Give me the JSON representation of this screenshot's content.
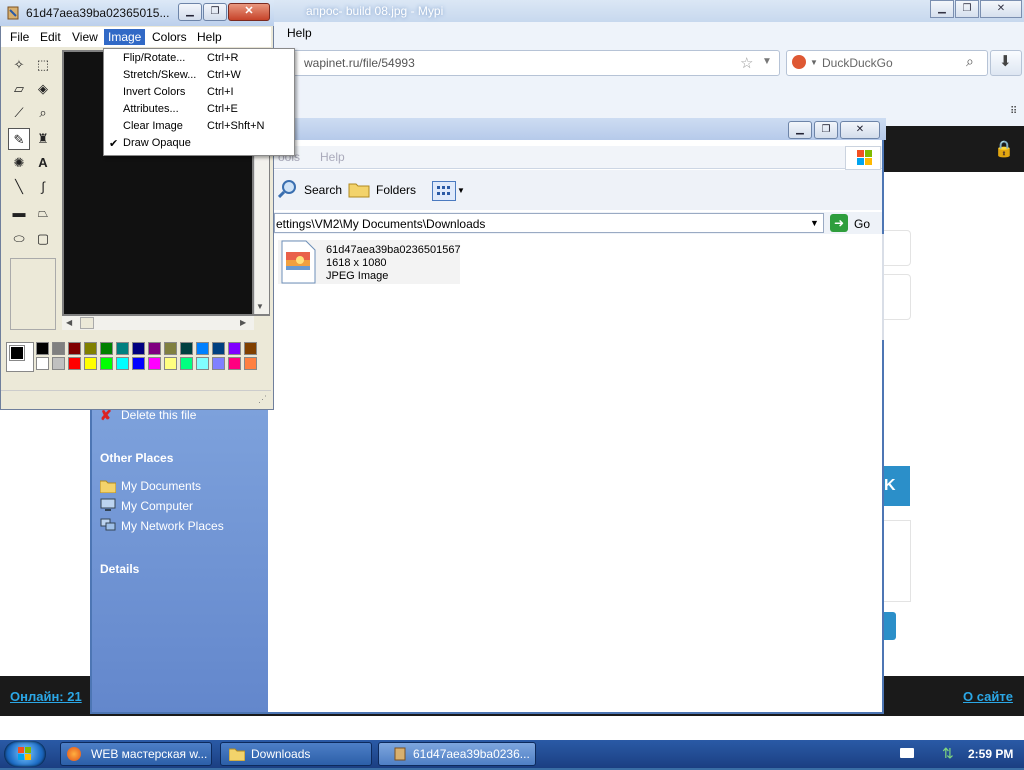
{
  "firefox": {
    "title": "апрос- build 08.jpg - Мурі",
    "menu_help": "Help",
    "url": "wapinet.ru/file/54993",
    "search_placeholder": "DuckDuckGo",
    "site": {
      "online": "Онлайн: 21",
      "about": "О сайте",
      "blue_box_text": "K"
    }
  },
  "explorer": {
    "menu_tools": "ools",
    "menu_help": "Help",
    "toolbar_search": "Search",
    "toolbar_folders": "Folders",
    "address": "ettings\\VM2\\My Documents\\Downloads",
    "go": "Go",
    "file": {
      "name": "61d47aea39ba0236501567",
      "dimensions": "1618 x 1080",
      "type": "JPEG Image"
    },
    "sidebar": {
      "delete_file": "Delete this file",
      "other_places_title": "Other Places",
      "other_places": [
        "My Documents",
        "My Computer",
        "My Network Places"
      ],
      "details_title": "Details"
    }
  },
  "paint": {
    "title": "61d47aea39ba02365015...",
    "menu": [
      "File",
      "Edit",
      "View",
      "Image",
      "Colors",
      "Help"
    ],
    "image_menu": [
      {
        "label": "Flip/Rotate...",
        "shortcut": "Ctrl+R"
      },
      {
        "label": "Stretch/Skew...",
        "shortcut": "Ctrl+W"
      },
      {
        "label": "Invert Colors",
        "shortcut": "Ctrl+I"
      },
      {
        "label": "Attributes...",
        "shortcut": "Ctrl+E"
      },
      {
        "label": "Clear Image",
        "shortcut": "Ctrl+Shft+N"
      },
      {
        "label": "Draw Opaque",
        "shortcut": "",
        "checked": true
      }
    ],
    "palette_top": [
      "#000000",
      "#808080",
      "#800000",
      "#808000",
      "#008000",
      "#008080",
      "#000080",
      "#800080",
      "#808040",
      "#004040",
      "#0080ff",
      "#004080",
      "#8000ff",
      "#804000"
    ],
    "palette_bottom": [
      "#ffffff",
      "#c0c0c0",
      "#ff0000",
      "#ffff00",
      "#00ff00",
      "#00ffff",
      "#0000ff",
      "#ff00ff",
      "#ffff80",
      "#00ff80",
      "#80ffff",
      "#8080ff",
      "#ff0080",
      "#ff8040"
    ]
  },
  "taskbar": {
    "items": [
      "WEB мастерская w...",
      "Downloads",
      "61d47aea39ba0236..."
    ],
    "clock": "2:59 PM"
  }
}
